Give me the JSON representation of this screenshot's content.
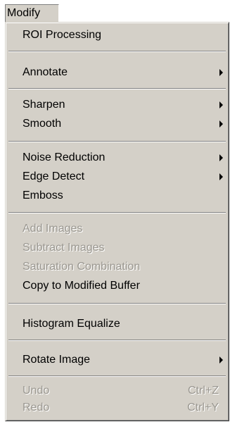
{
  "menu": {
    "title": "Modify",
    "items": {
      "roi": "ROI Processing",
      "annotate": "Annotate",
      "sharpen": "Sharpen",
      "smooth": "Smooth",
      "noise_reduction": "Noise Reduction",
      "edge_detect": "Edge Detect",
      "emboss": "Emboss",
      "add_images": "Add Images",
      "subtract_images": "Subtract Images",
      "saturation_combination": "Saturation Combination",
      "copy_to_modified_buffer": "Copy to Modified Buffer",
      "histogram_equalize": "Histogram Equalize",
      "rotate_image": "Rotate Image",
      "undo": "Undo",
      "undo_shortcut": "Ctrl+Z",
      "redo": "Redo",
      "redo_shortcut": "Ctrl+Y"
    }
  },
  "colors": {
    "menu_face": "#d4d0c8",
    "disabled_text": "#9a9790",
    "shadow": "#808080"
  }
}
